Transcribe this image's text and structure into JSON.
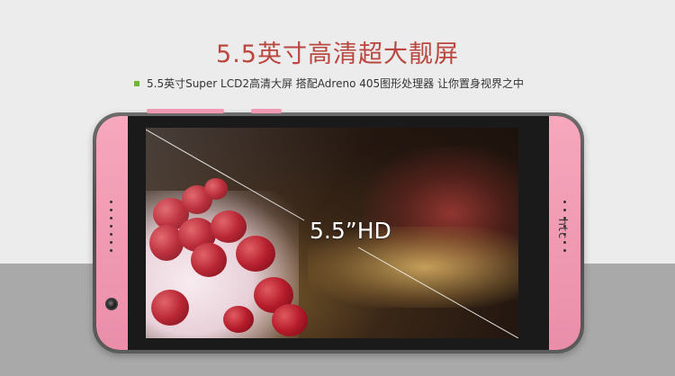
{
  "header": {
    "title": "5.5英寸高清超大靓屏",
    "subtitle": "5.5英寸Super LCD2高清大屏 搭配Adreno 405图形处理器 让你置身视界之中"
  },
  "phone": {
    "brand": "htc",
    "screen_label": "5.5”HD"
  },
  "colors": {
    "title": "#b9473f",
    "bullet": "#71b43a",
    "phone_pink": "#f09bb3",
    "background_top": "#ececec",
    "background_bottom": "#a9a9a9"
  },
  "icons": {
    "bullet": "square-bullet-icon",
    "camera": "front-camera-icon",
    "speaker": "speaker-grille-icon"
  }
}
